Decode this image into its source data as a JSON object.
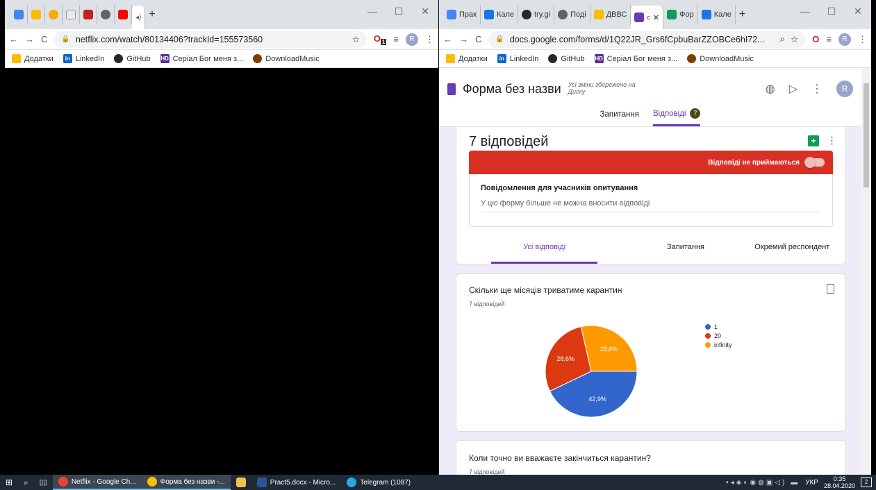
{
  "left_browser": {
    "tabs": [
      "Netflix"
    ],
    "url": "netflix.com/watch/80134406?trackId=155573560",
    "ext_badge": "1",
    "profile": "R"
  },
  "bookmarks": [
    "Додатки",
    "LinkedIn",
    "GitHub",
    "Серіал Бог меня з...",
    "DownloadMusic"
  ],
  "right_browser": {
    "tabs": [
      "Прак",
      "Кале",
      "try.gi",
      "Поді",
      "ДВВС",
      "Фор",
      "Кале"
    ],
    "url": "docs.google.com/forms/d/1Q22JR_Grs6fCpbuBarZZOBCe6hI72...",
    "profile": "R"
  },
  "forms": {
    "title": "Форма без назви",
    "saved_note": "Усі зміни збережено на Диску",
    "nav_questions": "Запитання",
    "nav_responses": "Відповіді",
    "responses_badge": "7",
    "responses_heading": "7 відповідей",
    "not_accepting": "Відповіді не приймаються",
    "message_label": "Повідомлення для учасників опитування",
    "message_text": "У цю форму більше не можна вносити відповіді",
    "subtabs": [
      "Усі відповіді",
      "Запитання",
      "Окремий респондент"
    ],
    "q1_title": "Скільки ще місяців триватиме карантин",
    "q1_count": "7 відповідей",
    "q2_title": "Коли точно ви вважаєте закінчиться карантин?",
    "q2_count": "7 відповідей"
  },
  "chart_data": {
    "type": "pie",
    "categories": [
      "1",
      "20",
      "infinity"
    ],
    "values": [
      42.9,
      28.6,
      28.6
    ],
    "labels": [
      "42,9%",
      "28,6%",
      "28,6%"
    ],
    "colors": [
      "#3366cc",
      "#dc3912",
      "#ff9900"
    ],
    "legend_position": "right"
  },
  "taskbar": {
    "items": [
      "Netflix - Google Ch...",
      "Форма без назви -...",
      "Pract5.docx - Micro...",
      "Telegram (1087)"
    ],
    "lang": "УКР",
    "time": "0:35",
    "date": "28.04.2020",
    "notif": "2"
  }
}
